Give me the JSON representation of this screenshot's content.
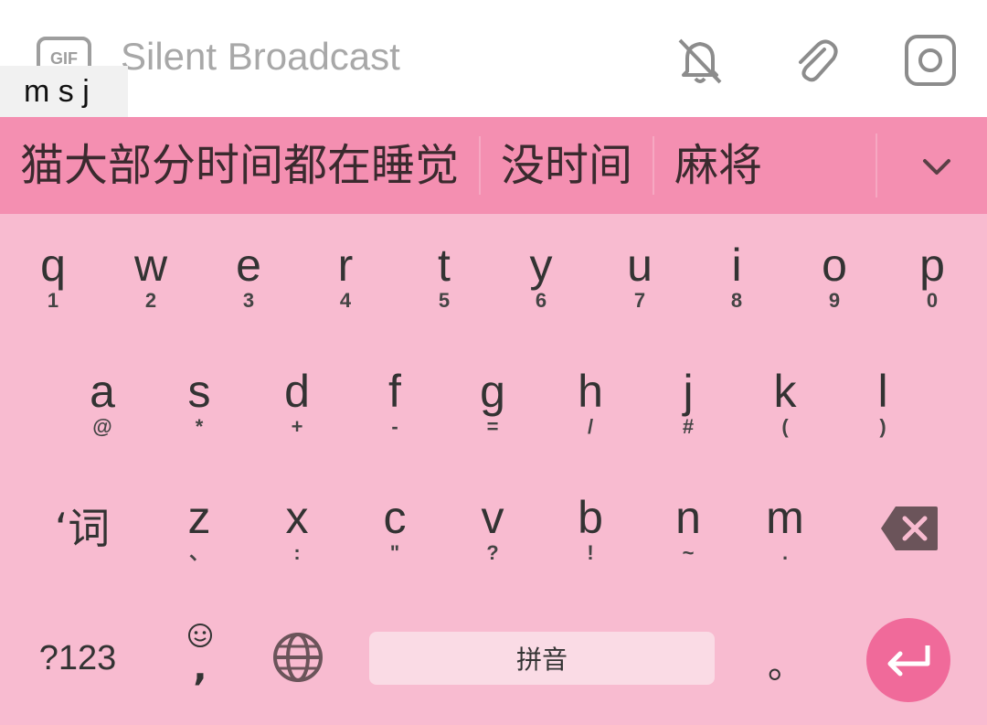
{
  "compose": {
    "gif_label": "GIF",
    "placeholder": "Silent Broadcast",
    "composition_text": "m s j"
  },
  "candidates": {
    "items": [
      "猫大部分时间都在睡觉",
      "没时间",
      "麻将"
    ]
  },
  "keyboard": {
    "row1": [
      {
        "main": "q",
        "sub": "1"
      },
      {
        "main": "w",
        "sub": "2"
      },
      {
        "main": "e",
        "sub": "3"
      },
      {
        "main": "r",
        "sub": "4"
      },
      {
        "main": "t",
        "sub": "5"
      },
      {
        "main": "y",
        "sub": "6"
      },
      {
        "main": "u",
        "sub": "7"
      },
      {
        "main": "i",
        "sub": "8"
      },
      {
        "main": "o",
        "sub": "9"
      },
      {
        "main": "p",
        "sub": "0"
      }
    ],
    "row2": [
      {
        "main": "a",
        "sub": "@"
      },
      {
        "main": "s",
        "sub": "*"
      },
      {
        "main": "d",
        "sub": "+"
      },
      {
        "main": "f",
        "sub": "-"
      },
      {
        "main": "g",
        "sub": "="
      },
      {
        "main": "h",
        "sub": "/"
      },
      {
        "main": "j",
        "sub": "#"
      },
      {
        "main": "k",
        "sub": "("
      },
      {
        "main": "l",
        "sub": ")"
      }
    ],
    "row3": [
      {
        "main": "z",
        "sub": "、"
      },
      {
        "main": "x",
        "sub": ":"
      },
      {
        "main": "c",
        "sub": "\""
      },
      {
        "main": "v",
        "sub": "?"
      },
      {
        "main": "b",
        "sub": "!"
      },
      {
        "main": "n",
        "sub": "~"
      },
      {
        "main": "m",
        "sub": "."
      }
    ],
    "word_key": "‘词",
    "symbols_key": "?123",
    "emoji_key_sub": ",",
    "space_label": "拼音",
    "period_key": "。"
  },
  "colors": {
    "candidate_bar": "#f48fb1",
    "keyboard_bg": "#f8bbd0",
    "enter_bg": "#f06a9a"
  }
}
